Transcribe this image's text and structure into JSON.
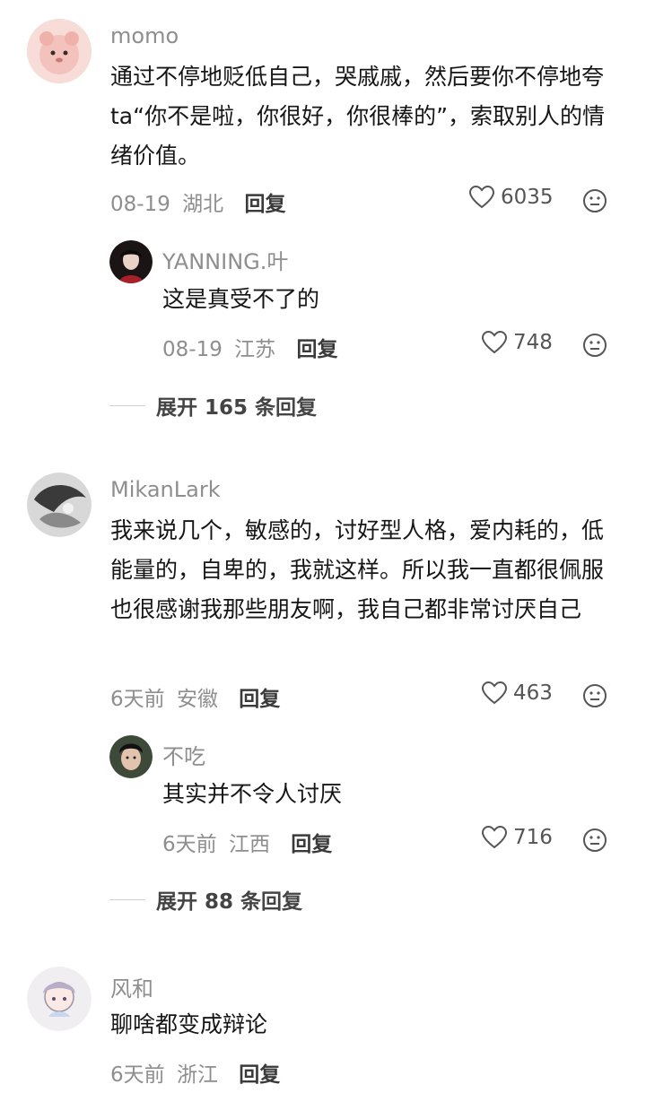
{
  "comments": [
    {
      "username": "momo",
      "text": "通过不停地贬低自己，哭戚戚，然后要你不停地夸ta“你不是啦，你很好，你很棒的”，索取别人的情绪价值。",
      "date": "08-19",
      "location": "湖北",
      "reply_label": "回复",
      "likes": "6035",
      "reply": {
        "username": "YANNING.叶",
        "text": "这是真受不了的",
        "date": "08-19",
        "location": "江苏",
        "reply_label": "回复",
        "likes": "748"
      },
      "expand_label": "展开 165 条回复"
    },
    {
      "username": "MikanLark",
      "text": "我来说几个，敏感的，讨好型人格，爱内耗的，低能量的，自卑的，我就这样。所以我一直都很佩服也很感谢我那些朋友啊，我自己都非常讨厌自己",
      "date": "6天前",
      "location": "安徽",
      "reply_label": "回复",
      "likes": "463",
      "reply": {
        "username": "不吃",
        "text": "其实并不令人讨厌",
        "date": "6天前",
        "location": "江西",
        "reply_label": "回复",
        "likes": "716"
      },
      "expand_label": "展开 88 条回复"
    },
    {
      "username": "风和",
      "text": "聊啥都变成辩论",
      "date": "6天前",
      "location": "浙江",
      "reply_label": "回复"
    }
  ]
}
